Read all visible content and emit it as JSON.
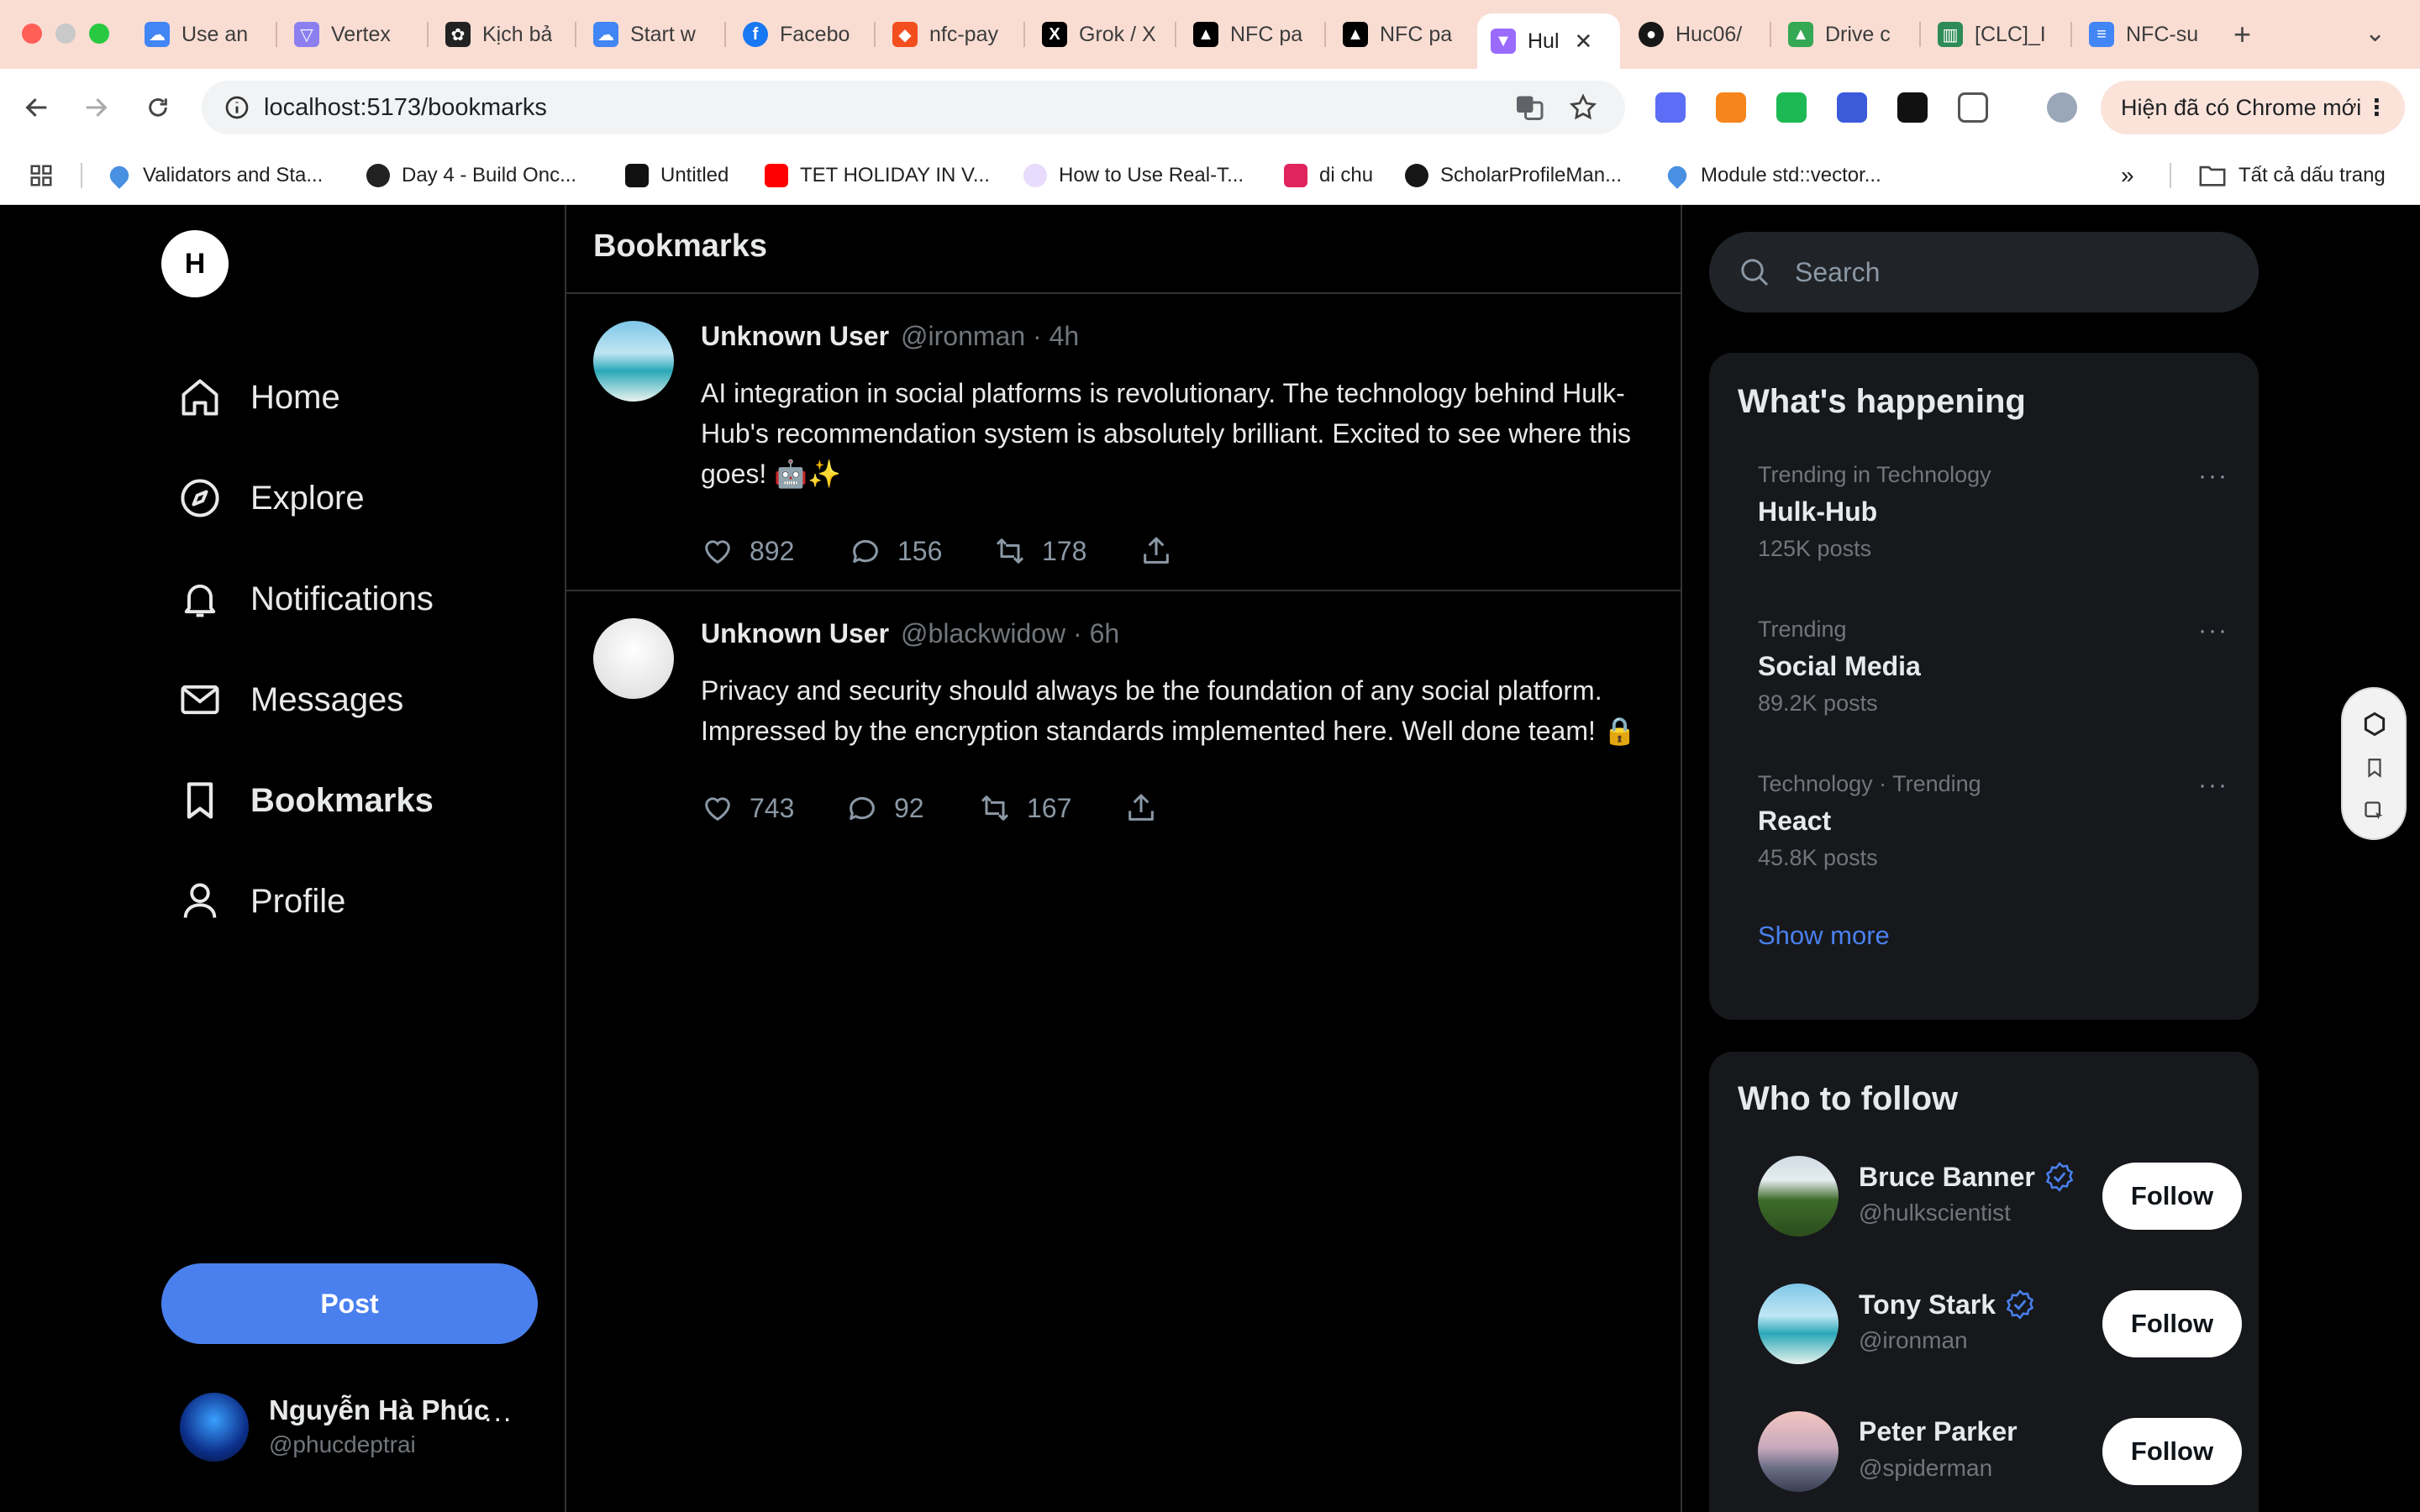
{
  "browser": {
    "tabs": [
      {
        "title": "Use an",
        "icon": "google-cloud-icon",
        "color": "#4285f4"
      },
      {
        "title": "Vertex",
        "icon": "vertex-icon",
        "color": "#8b7ff0"
      },
      {
        "title": "Kịch bả",
        "icon": "openai-icon",
        "color": "#222222"
      },
      {
        "title": "Start w",
        "icon": "google-cloud-icon",
        "color": "#4285f4"
      },
      {
        "title": "Facebo",
        "icon": "facebook-icon",
        "color": "#1877f2"
      },
      {
        "title": "nfc-pay",
        "icon": "figma-icon",
        "color": "#f24e1e"
      },
      {
        "title": "Grok / X",
        "icon": "x-icon",
        "color": "#000000"
      },
      {
        "title": "NFC pa",
        "icon": "vercel-icon",
        "color": "#000000"
      },
      {
        "title": "NFC pa",
        "icon": "vercel-icon",
        "color": "#000000"
      },
      {
        "title": "Hul",
        "icon": "vite-icon",
        "color": "#9b6bff",
        "active": true
      },
      {
        "title": "Huc06/",
        "icon": "github-icon",
        "color": "#181717"
      },
      {
        "title": "Drive c",
        "icon": "google-drive-icon",
        "color": "#34a853"
      },
      {
        "title": "[CLC]_I",
        "icon": "library-icon",
        "color": "#2e8b57"
      },
      {
        "title": "NFC-su",
        "icon": "google-docs-icon",
        "color": "#4285f4"
      }
    ],
    "url": "localhost:5173/bookmarks",
    "update_button": "Hiện đã có Chrome mới",
    "bookmarks": [
      {
        "label": "Validators and Sta...",
        "icon": "droplet-icon",
        "color": "#4a90e2"
      },
      {
        "label": "Day 4 - Build Onc...",
        "icon": "build-icon",
        "color": "#222222"
      },
      {
        "label": "Untitled",
        "icon": "grid-icon",
        "color": "#111111"
      },
      {
        "label": "TET HOLIDAY IN V...",
        "icon": "youtube-icon",
        "color": "#ff0000"
      },
      {
        "label": "How to Use Real-T...",
        "icon": "circle-icon",
        "color": "#c9a7f5"
      },
      {
        "label": "di chu",
        "icon": "wave-icon",
        "color": "#e0245e"
      },
      {
        "label": "ScholarProfileMan...",
        "icon": "github-icon",
        "color": "#181717"
      },
      {
        "label": "Module std::vector...",
        "icon": "droplet-icon",
        "color": "#4a90e2"
      }
    ],
    "all_bookmarks": "Tất cả dấu trang"
  },
  "app": {
    "logo_letter": "H",
    "nav": [
      {
        "label": "Home",
        "icon": "home-icon"
      },
      {
        "label": "Explore",
        "icon": "compass-icon"
      },
      {
        "label": "Notifications",
        "icon": "bell-icon"
      },
      {
        "label": "Messages",
        "icon": "mail-icon"
      },
      {
        "label": "Bookmarks",
        "icon": "bookmark-icon",
        "active": true
      },
      {
        "label": "Profile",
        "icon": "user-icon"
      }
    ],
    "post_button": "Post",
    "account": {
      "name": "Nguyễn Hà Phúc",
      "handle": "@phucdeptrai",
      "more": "..."
    },
    "page_title": "Bookmarks",
    "posts": [
      {
        "name": "Unknown User",
        "meta": "@ironman · 4h",
        "text": "AI integration in social platforms is revolutionary. The technology behind Hulk-Hub's recommendation system is absolutely brilliant. Excited to see where this goes! 🤖✨",
        "likes": "892",
        "replies": "156",
        "reposts": "178"
      },
      {
        "name": "Unknown User",
        "meta": "@blackwidow · 6h",
        "text": "Privacy and security should always be the foundation of any social platform. Impressed by the encryption standards implemented here. Well done team! 🔒",
        "likes": "743",
        "replies": "92",
        "reposts": "167"
      }
    ],
    "search_placeholder": "Search",
    "trending": {
      "title": "What's happening",
      "items": [
        {
          "category": "Trending in Technology",
          "title": "Hulk-Hub",
          "count": "125K posts"
        },
        {
          "category": "Trending",
          "title": "Social Media",
          "count": "89.2K posts"
        },
        {
          "category": "Technology · Trending",
          "title": "React",
          "count": "45.8K posts"
        }
      ],
      "more_dots": "···",
      "show_more": "Show more"
    },
    "who_to_follow": {
      "title": "Who to follow",
      "follow_label": "Follow",
      "users": [
        {
          "name": "Bruce Banner",
          "handle": "@hulkscientist",
          "verified": true
        },
        {
          "name": "Tony Stark",
          "handle": "@ironman",
          "verified": true
        },
        {
          "name": "Peter Parker",
          "handle": "@spiderman",
          "verified": false
        }
      ]
    },
    "colors": {
      "accent": "#4a80ee",
      "background": "#000000",
      "card": "#16181c"
    }
  }
}
